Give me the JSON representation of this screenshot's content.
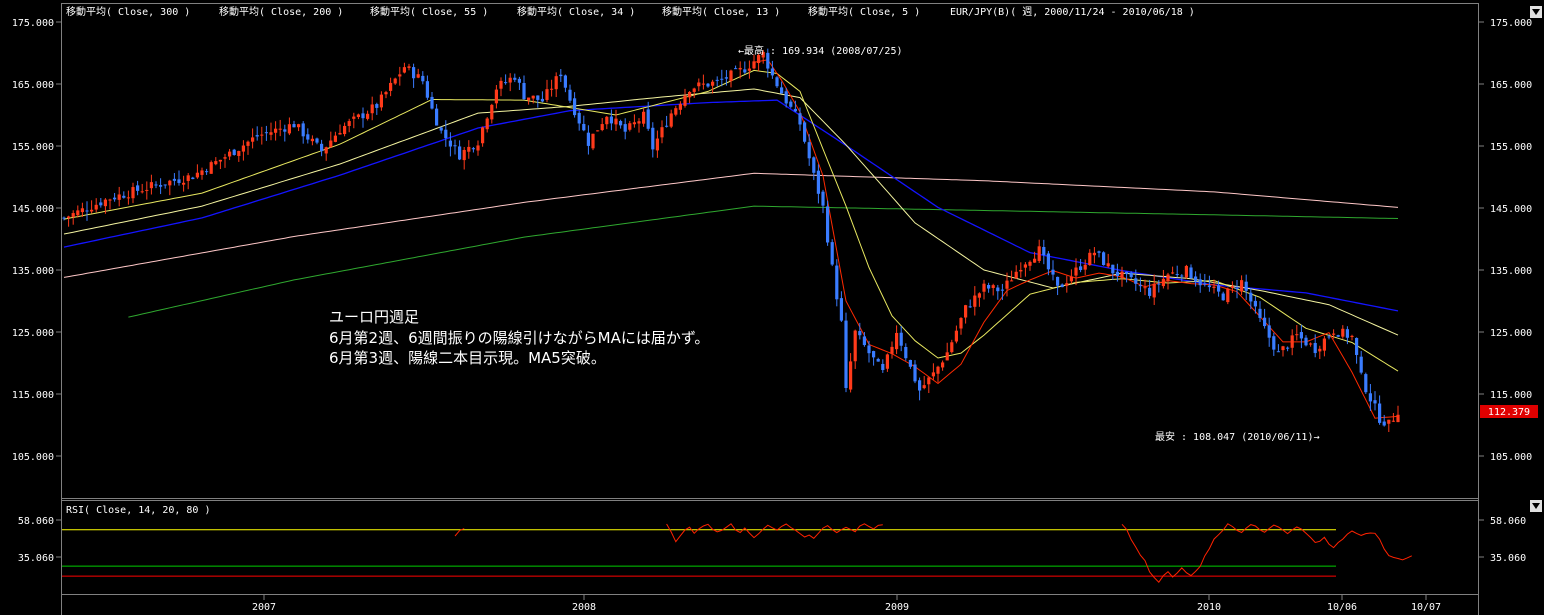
{
  "header": {
    "main_legend": [
      "移動平均( Close, 300 )",
      "移動平均( Close, 200 )",
      "移動平均( Close, 55 )",
      "移動平均( Close, 34 )",
      "移動平均( Close, 13 )",
      "移動平均( Close, 5 )",
      "EUR/JPY(B)( 週, 2000/11/24 - 2010/06/18 )"
    ],
    "rsi_legend": "RSI( Close, 14, 20, 80 )"
  },
  "annotation": {
    "lines": [
      "ユーロ円週足",
      "6月第2週、6週間振りの陽線引けながらMAには届かず。",
      "6月第3週、陽線二本目示現。MA5突破。"
    ],
    "high_label": "←最高 : 169.934 (2008/07/25)",
    "low_label": "最安 : 108.047 (2010/06/11)→",
    "last_price": "112.379"
  },
  "colors": {
    "up": "#ff3a1a",
    "down": "#3a7cff",
    "ma300": "#ffc8c8",
    "ma200": "#2fa82f",
    "ma55": "#1414ff",
    "ma34": "#f4f4a0",
    "ma13": "#e8e860",
    "ma5": "#ff2a00",
    "rsi": "#ff2200",
    "rsi_high": "#ffff00",
    "rsi_mid": "#00cc00",
    "rsi_low": "#ff0000",
    "frame": "#808080",
    "price_box": "#e00000"
  },
  "chart_data": [
    {
      "type": "candlestick",
      "title": "EUR/JPY(B)( 週, 2000/11/24 - 2010/06/18 )",
      "x_start": "2006-05-26",
      "x_end": "2010-06-18",
      "period": "weekly",
      "ylim": [
        100,
        178
      ],
      "yticks": [
        "175.000",
        "165.000",
        "155.000",
        "145.000",
        "135.000",
        "125.000",
        "115.000",
        "105.000"
      ],
      "xticks": [
        "2007",
        "2008",
        "2009",
        "2010",
        "10/06",
        "10/07"
      ],
      "close_path": [
        [
          0,
          143.4
        ],
        [
          10,
          146.6
        ],
        [
          20,
          148.7
        ],
        [
          28,
          150.2
        ],
        [
          34,
          152.8
        ],
        [
          42,
          156.6
        ],
        [
          50,
          158.5
        ],
        [
          56,
          154.2
        ],
        [
          60,
          157.7
        ],
        [
          68,
          161.5
        ],
        [
          74,
          167.8
        ],
        [
          78,
          165.5
        ],
        [
          80,
          160.9
        ],
        [
          82,
          157.3
        ],
        [
          86,
          153.6
        ],
        [
          90,
          155.8
        ],
        [
          94,
          164.4
        ],
        [
          98,
          166.3
        ],
        [
          100,
          163.2
        ],
        [
          104,
          162.3
        ],
        [
          108,
          166.8
        ],
        [
          110,
          162.5
        ],
        [
          114,
          155.6
        ],
        [
          118,
          160.1
        ],
        [
          122,
          157.3
        ],
        [
          126,
          159.8
        ],
        [
          128,
          154.7
        ],
        [
          132,
          160.3
        ],
        [
          136,
          164.4
        ],
        [
          142,
          165.3
        ],
        [
          148,
          167.5
        ],
        [
          152,
          169.9
        ],
        [
          154,
          166.3
        ],
        [
          157,
          162.3
        ],
        [
          160,
          158.6
        ],
        [
          163,
          150.2
        ],
        [
          165,
          145.1
        ],
        [
          167,
          135.3
        ],
        [
          169,
          126.4
        ],
        [
          170,
          115.4
        ],
        [
          172,
          124.9
        ],
        [
          175,
          121.6
        ],
        [
          178,
          118.4
        ],
        [
          181,
          125.2
        ],
        [
          184,
          119.2
        ],
        [
          186,
          115.6
        ],
        [
          189,
          118.2
        ],
        [
          192,
          121.7
        ],
        [
          196,
          128.8
        ],
        [
          200,
          132.2
        ],
        [
          204,
          131.7
        ],
        [
          208,
          135.8
        ],
        [
          212,
          138.2
        ],
        [
          216,
          131.9
        ],
        [
          220,
          134.9
        ],
        [
          224,
          137.9
        ],
        [
          228,
          134.8
        ],
        [
          232,
          133.2
        ],
        [
          236,
          131.4
        ],
        [
          240,
          134.3
        ],
        [
          244,
          134.9
        ],
        [
          248,
          132.4
        ],
        [
          252,
          130.8
        ],
        [
          256,
          133.1
        ],
        [
          260,
          126.8
        ],
        [
          264,
          121.5
        ],
        [
          268,
          124.4
        ],
        [
          272,
          122.3
        ],
        [
          276,
          125.3
        ],
        [
          280,
          124.2
        ],
        [
          282,
          117.7
        ],
        [
          284,
          114.3
        ],
        [
          286,
          111.1
        ],
        [
          288,
          110.1
        ],
        [
          289,
          111.2
        ],
        [
          290,
          112.4
        ]
      ]
    },
    {
      "type": "line",
      "title": "移動平均",
      "series": [
        {
          "name": "移動平均( Close, 300 )",
          "x": [
            0,
            50,
            100,
            150,
            200,
            250,
            290
          ],
          "values": [
            133.8,
            140.4,
            145.9,
            150.6,
            149.4,
            147.6,
            145.1
          ]
        },
        {
          "name": "移動平均( Close, 200 )",
          "x": [
            14,
            50,
            100,
            150,
            200,
            250,
            290
          ],
          "values": [
            127.4,
            133.4,
            140.3,
            145.3,
            144.6,
            143.9,
            143.3
          ]
        },
        {
          "name": "移動平均( Close, 55 )",
          "x": [
            0,
            30,
            60,
            90,
            110,
            140,
            155,
            170,
            190,
            210,
            230,
            250,
            270,
            290
          ],
          "values": [
            138.7,
            143.4,
            150.3,
            157.9,
            160.7,
            162.0,
            162.4,
            155.1,
            145.1,
            137.8,
            134.9,
            132.6,
            131.3,
            128.4
          ]
        },
        {
          "name": "移動平均( Close, 34 )",
          "x": [
            0,
            30,
            60,
            90,
            110,
            130,
            150,
            160,
            170,
            185,
            200,
            215,
            230,
            245,
            260,
            275,
            290
          ],
          "values": [
            140.8,
            145.3,
            152.1,
            160.3,
            161.4,
            162.9,
            164.2,
            162.8,
            155.2,
            142.6,
            135.0,
            132.1,
            134.5,
            133.6,
            131.7,
            129.4,
            124.5
          ]
        },
        {
          "name": "移動平均( Close, 13 )",
          "x": [
            0,
            30,
            60,
            80,
            100,
            120,
            140,
            150,
            155,
            160,
            165,
            170,
            175,
            180,
            185,
            190,
            195,
            200,
            210,
            220,
            230,
            240,
            250,
            260,
            270,
            280,
            290
          ],
          "values": [
            143.2,
            147.4,
            155.3,
            162.5,
            162.4,
            160.0,
            163.8,
            167.2,
            166.7,
            163.8,
            154.5,
            145.3,
            135.4,
            127.6,
            123.6,
            120.8,
            121.6,
            124.5,
            131.1,
            133.0,
            133.6,
            132.9,
            133.3,
            130.6,
            125.6,
            123.3,
            118.7
          ]
        },
        {
          "name": "移動平均( Close, 5 )",
          "x": [
            150,
            153,
            156,
            160,
            165,
            170,
            175,
            180,
            185,
            190,
            195,
            200,
            205,
            210,
            215,
            220,
            225,
            230,
            235,
            240,
            245,
            250,
            255,
            260,
            265,
            270,
            275,
            280,
            285,
            290
          ],
          "values": [
            168.5,
            168.9,
            165.6,
            160.5,
            150.2,
            130.0,
            123.0,
            121.5,
            119.4,
            116.7,
            119.8,
            126.6,
            131.7,
            133.4,
            134.9,
            133.7,
            134.5,
            133.9,
            132.3,
            133.3,
            132.8,
            132.6,
            131.5,
            127.5,
            123.4,
            123.4,
            124.9,
            118.5,
            111.1,
            111.4
          ]
        }
      ]
    },
    {
      "type": "line",
      "title": "RSI( Close, 14, 20, 80 )",
      "yticks": [
        "58.060",
        "35.060"
      ],
      "ylim": [
        20,
        65
      ],
      "levels": [
        {
          "value": 52.0
        },
        {
          "value": 29.4
        },
        {
          "value": 23.2
        }
      ],
      "segments": [
        [
          [
            170,
            48.1
          ],
          [
            172,
            51.5
          ],
          [
            174,
            52.7
          ]
        ],
        [
          [
            262,
            55.6
          ],
          [
            264,
            50.6
          ],
          [
            266,
            44.6
          ],
          [
            268,
            48.3
          ],
          [
            270,
            51.9
          ],
          [
            272,
            53.6
          ],
          [
            274,
            49.8
          ],
          [
            276,
            52.5
          ],
          [
            278,
            54.3
          ],
          [
            280,
            55.4
          ],
          [
            282,
            52.3
          ],
          [
            284,
            50.7
          ],
          [
            286,
            51.6
          ],
          [
            288,
            53.6
          ],
          [
            290,
            55.7
          ],
          [
            292,
            51.8
          ],
          [
            294,
            50.3
          ],
          [
            296,
            53.1
          ],
          [
            298,
            49.9
          ],
          [
            300,
            47.1
          ],
          [
            302,
            49.5
          ],
          [
            304,
            52.4
          ],
          [
            306,
            54.8
          ],
          [
            308,
            53.2
          ],
          [
            310,
            51.8
          ],
          [
            312,
            54.1
          ],
          [
            314,
            55.6
          ],
          [
            316,
            53.4
          ],
          [
            318,
            51.7
          ],
          [
            320,
            49.6
          ],
          [
            322,
            47.5
          ],
          [
            324,
            48.7
          ],
          [
            326,
            46.7
          ],
          [
            328,
            49.8
          ],
          [
            330,
            53.0
          ],
          [
            332,
            54.6
          ],
          [
            334,
            52.1
          ],
          [
            336,
            50.2
          ],
          [
            338,
            52.0
          ],
          [
            340,
            53.5
          ],
          [
            342,
            52.2
          ],
          [
            344,
            50.8
          ],
          [
            346,
            54.3
          ],
          [
            348,
            55.7
          ],
          [
            350,
            54.0
          ],
          [
            352,
            52.5
          ],
          [
            354,
            54.7
          ],
          [
            356,
            55.1
          ]
        ],
        [
          [
            460,
            55.4
          ],
          [
            462,
            52.2
          ],
          [
            464,
            45.8
          ],
          [
            466,
            41.2
          ],
          [
            468,
            36.2
          ],
          [
            470,
            32.8
          ],
          [
            472,
            25.8
          ],
          [
            474,
            22.3
          ],
          [
            476,
            19.4
          ],
          [
            478,
            23.5
          ],
          [
            480,
            25.9
          ],
          [
            482,
            22.6
          ],
          [
            484,
            25.1
          ],
          [
            486,
            28.3
          ],
          [
            488,
            25.3
          ],
          [
            490,
            23.5
          ],
          [
            492,
            26.1
          ],
          [
            494,
            29.2
          ],
          [
            496,
            35.8
          ],
          [
            498,
            40.3
          ],
          [
            500,
            46.2
          ],
          [
            502,
            48.9
          ],
          [
            504,
            51.8
          ],
          [
            506,
            55.7
          ],
          [
            508,
            54.0
          ],
          [
            510,
            51.6
          ],
          [
            512,
            50.3
          ],
          [
            514,
            53.0
          ],
          [
            516,
            55.2
          ],
          [
            518,
            54.3
          ],
          [
            520,
            51.9
          ],
          [
            522,
            50.4
          ],
          [
            524,
            52.8
          ],
          [
            526,
            54.9
          ],
          [
            528,
            53.7
          ],
          [
            530,
            51.8
          ],
          [
            532,
            49.6
          ],
          [
            534,
            51.9
          ],
          [
            536,
            53.7
          ],
          [
            538,
            52.4
          ],
          [
            540,
            49.8
          ],
          [
            542,
            47.2
          ],
          [
            544,
            44.1
          ],
          [
            546,
            44.8
          ],
          [
            548,
            47.3
          ],
          [
            550,
            43.0
          ],
          [
            552,
            40.9
          ],
          [
            554,
            44.1
          ],
          [
            556,
            46.2
          ],
          [
            558,
            49.3
          ],
          [
            560,
            51.2
          ],
          [
            562,
            49.7
          ],
          [
            564,
            48.5
          ],
          [
            566,
            49.6
          ],
          [
            568,
            50.0
          ],
          [
            570,
            49.8
          ],
          [
            572,
            46.1
          ],
          [
            574,
            40.0
          ],
          [
            576,
            35.9
          ],
          [
            578,
            34.8
          ],
          [
            580,
            34.1
          ],
          [
            582,
            33.3
          ],
          [
            584,
            34.5
          ],
          [
            586,
            35.8
          ]
        ]
      ]
    }
  ]
}
